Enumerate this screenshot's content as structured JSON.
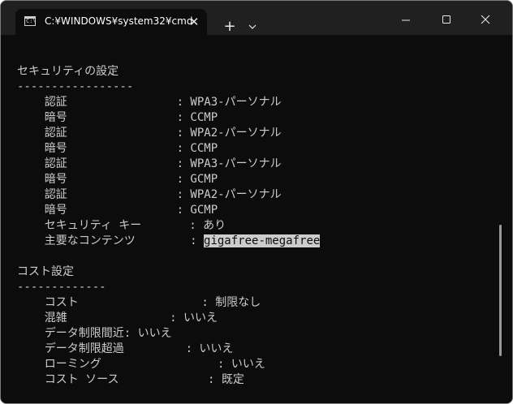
{
  "tab": {
    "title": "C:¥WINDOWS¥system32¥cmd",
    "icon": "cmd-icon",
    "prompt_glyph": "C:\\"
  },
  "titlebar": {
    "close_tab_glyph": "✕",
    "new_tab_glyph": "+",
    "dropdown_icon": "chevron-down-icon",
    "minimize_icon": "minimize-icon",
    "maximize_icon": "maximize-icon",
    "close_icon": "close-icon"
  },
  "terminal": {
    "security_heading": "セキュリティの設定",
    "security_rule": "-----------------",
    "auth1": "    認証                : WPA3-パーソナル",
    "cipher1": "    暗号                : CCMP",
    "auth2": "    認証                : WPA2-パーソナル",
    "cipher2": "    暗号                : CCMP",
    "auth3": "    認証                : WPA3-パーソナル",
    "cipher3": "    暗号                : GCMP",
    "auth4": "    認証                : WPA2-パーソナル",
    "cipher4": "    暗号                : GCMP",
    "key": "    セキュリティ キー       : あり",
    "content_label": "    主要なコンテンツ        : ",
    "content_value": "gigafree-megafree",
    "cost_heading": "コスト設定",
    "cost_rule": "-------------",
    "cost": "    コスト                  : 制限なし",
    "congestion": "    混雑               : いいえ",
    "near_limit": "    データ制限間近: いいえ",
    "over_limit": "    データ制限超過         : いいえ",
    "roaming": "    ローミング                 : いいえ",
    "cost_source": "    コスト ソース             : 既定"
  },
  "colors": {
    "terminal_bg": "#0c0c0c",
    "text": "#cccccc",
    "titlebar_bg": "#202020",
    "selection_bg": "#cccccc"
  }
}
